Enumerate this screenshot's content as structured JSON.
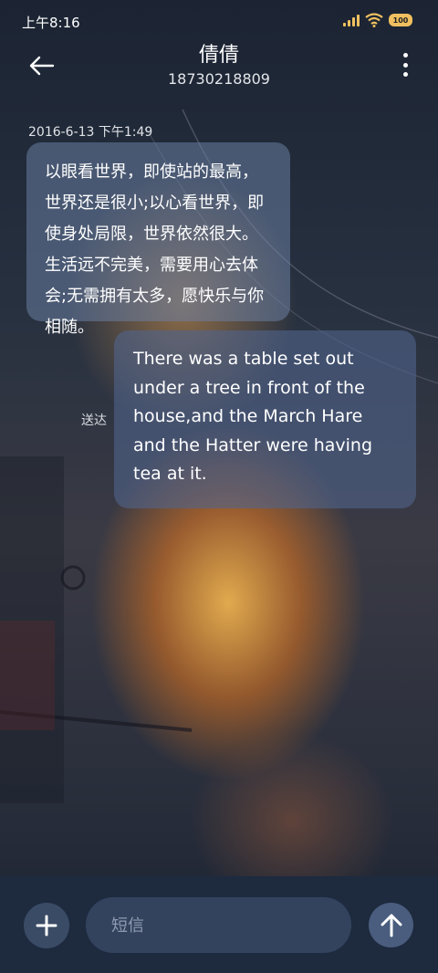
{
  "status_bar": {
    "time": "上午8:16",
    "battery": "100",
    "accent_color": "#f0c060"
  },
  "header": {
    "contact_name": "倩倩",
    "phone_number": "18730218809",
    "back_icon": "arrow-left-icon",
    "menu_icon": "more-vertical-icon"
  },
  "conversation": {
    "timestamp": "2016-6-13 下午1:49",
    "messages": [
      {
        "direction": "incoming",
        "text": "以眼看世界，即使站的最高，世界还是很小;以心看世界，即使身处局限，世界依然很大。生活远不完美，需要用心去体会;无需拥有太多，愿快乐与你相随。"
      },
      {
        "direction": "outgoing",
        "text": "There was a table set out under a tree in front of the house,and the March Hare and the Hatter were having tea at it.",
        "status": "送达"
      }
    ]
  },
  "composer": {
    "placeholder": "短信",
    "value": "",
    "add_icon": "plus-icon",
    "send_icon": "arrow-up-icon"
  }
}
